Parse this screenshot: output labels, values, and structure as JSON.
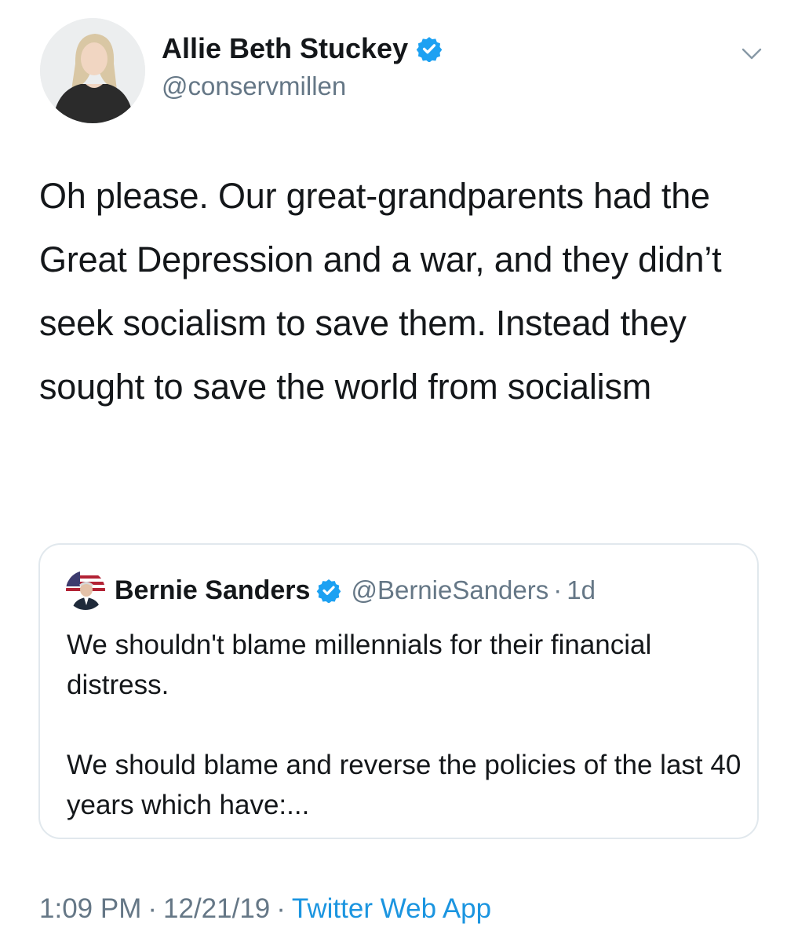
{
  "tweet": {
    "author": {
      "display_name": "Allie Beth Stuckey",
      "handle": "@conservmillen",
      "verified": true,
      "avatar_icon": "profile-photo-avatar"
    },
    "menu_icon": "chevron-down-icon",
    "text": "Oh please. Our great-grandparents had the Great Depression and a war, and they didn’t seek socialism to save them. Instead they sought to save the world from socialism",
    "timestamp": "1:09 PM",
    "date": "12/21/19",
    "separator": "·",
    "source": "Twitter Web App"
  },
  "quoted_tweet": {
    "author": {
      "display_name": "Bernie Sanders",
      "handle": "@BernieSanders",
      "verified": true,
      "avatar_icon": "profile-photo-avatar"
    },
    "separator": "·",
    "time": "1d",
    "paragraphs": [
      "We shouldn't blame millennials for their financial distress.",
      "We should blame and reverse the policies of the last 40 years which have:..."
    ]
  },
  "colors": {
    "text": "#14171a",
    "secondary": "#657786",
    "link": "#1b95e0",
    "verified": "#1da1f2",
    "border": "#e1e8ed"
  }
}
